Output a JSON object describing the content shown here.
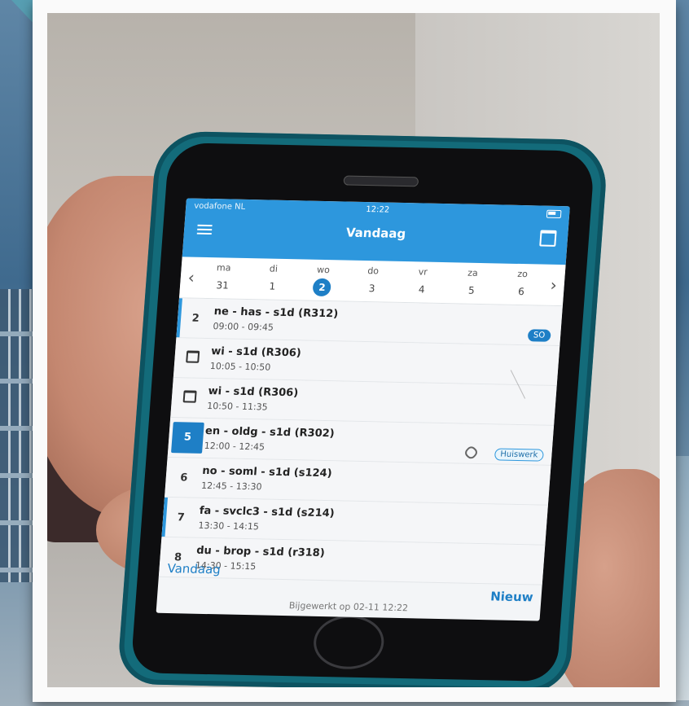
{
  "status_bar": {
    "carrier": "vodafone NL",
    "time": "12:22"
  },
  "app": {
    "title": "Vandaag"
  },
  "week": {
    "prev_icon": "chevron-left-icon",
    "next_icon": "chevron-right-icon",
    "days": [
      {
        "name": "ma",
        "num": "31"
      },
      {
        "name": "di",
        "num": "1"
      },
      {
        "name": "wo",
        "num": "2"
      },
      {
        "name": "do",
        "num": "3"
      },
      {
        "name": "vr",
        "num": "4"
      },
      {
        "name": "za",
        "num": "5"
      },
      {
        "name": "zo",
        "num": "6"
      }
    ],
    "selected": "2"
  },
  "lessons": [
    {
      "hour": "2",
      "title": "ne - has - s1d (R312)",
      "time": "09:00 - 09:45",
      "badge": "SO"
    },
    {
      "hour": "",
      "title": "wi - s1d (R306)",
      "time": "10:05 - 10:50"
    },
    {
      "hour": "",
      "title": "wi - s1d (R306)",
      "time": "10:50 - 11:35"
    },
    {
      "hour": "5",
      "title": "en - oldg - s1d (R302)",
      "time": "12:00 - 12:45",
      "badge": "Huiswerk"
    },
    {
      "hour": "6",
      "title": "no - soml - s1d (s124)",
      "time": "12:45 - 13:30"
    },
    {
      "hour": "7",
      "title": "fa - svclc3 - s1d (s214)",
      "time": "13:30 - 14:15"
    },
    {
      "hour": "8",
      "title": "du - brop - s1d (r318)",
      "time": "14:30 - 15:15"
    }
  ],
  "footer": {
    "today_button": "Vandaag",
    "new_button": "Nieuw",
    "updated": "Bijgewerkt op 02-11 12:22"
  },
  "colors": {
    "accent": "#2d97dd",
    "selected": "#1e7fc6",
    "case": "#136b7a"
  }
}
